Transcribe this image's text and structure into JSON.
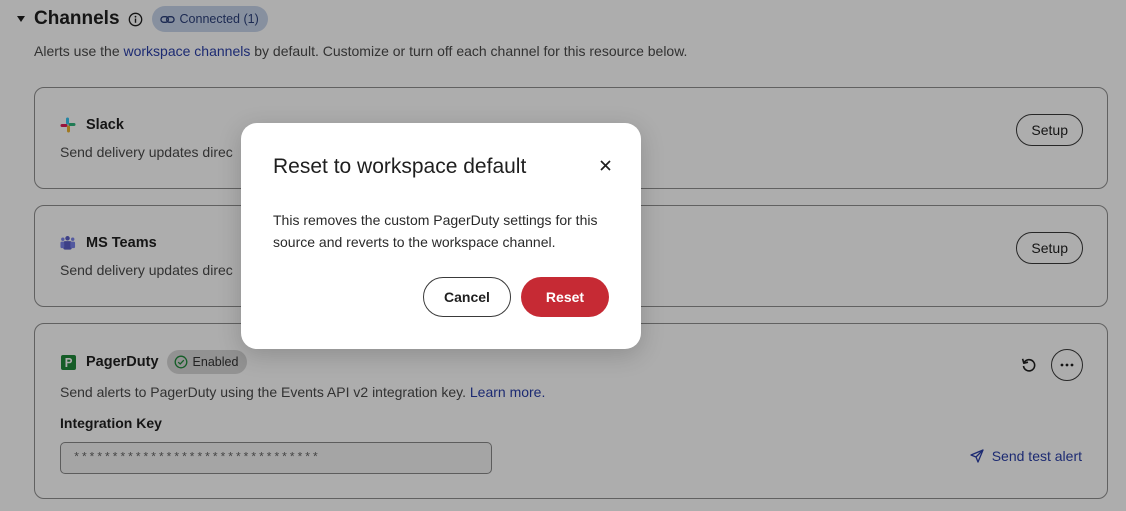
{
  "section": {
    "title": "Channels",
    "badge": "Connected (1)",
    "subtitle_prefix": "Alerts use the ",
    "subtitle_link": "workspace channels",
    "subtitle_suffix": " by default. Customize or turn off each channel for this resource below."
  },
  "cards": {
    "slack": {
      "name": "Slack",
      "description": "Send delivery updates direc",
      "button": "Setup",
      "icon": "slack-icon"
    },
    "teams": {
      "name": "MS Teams",
      "description": "Send delivery updates direc",
      "button": "Setup",
      "icon": "ms-teams-icon"
    },
    "pagerduty": {
      "name": "PagerDuty",
      "badge": "Enabled",
      "description": "Send alerts to PagerDuty using the Events API v2 integration key. ",
      "learn_more": "Learn more.",
      "key_label": "Integration Key",
      "key_value": "********************************",
      "send_test": "Send test alert",
      "icon": "pagerduty-icon"
    }
  },
  "modal": {
    "title": "Reset to workspace default",
    "body": "This removes the custom PagerDuty settings for this source and reverts to the workspace channel.",
    "cancel": "Cancel",
    "confirm": "Reset"
  },
  "colors": {
    "accent": "#2a3fa8",
    "danger": "#c62a34",
    "badge_connected_bg": "#c8d4ea",
    "pagerduty_green": "#1f8a3a"
  }
}
